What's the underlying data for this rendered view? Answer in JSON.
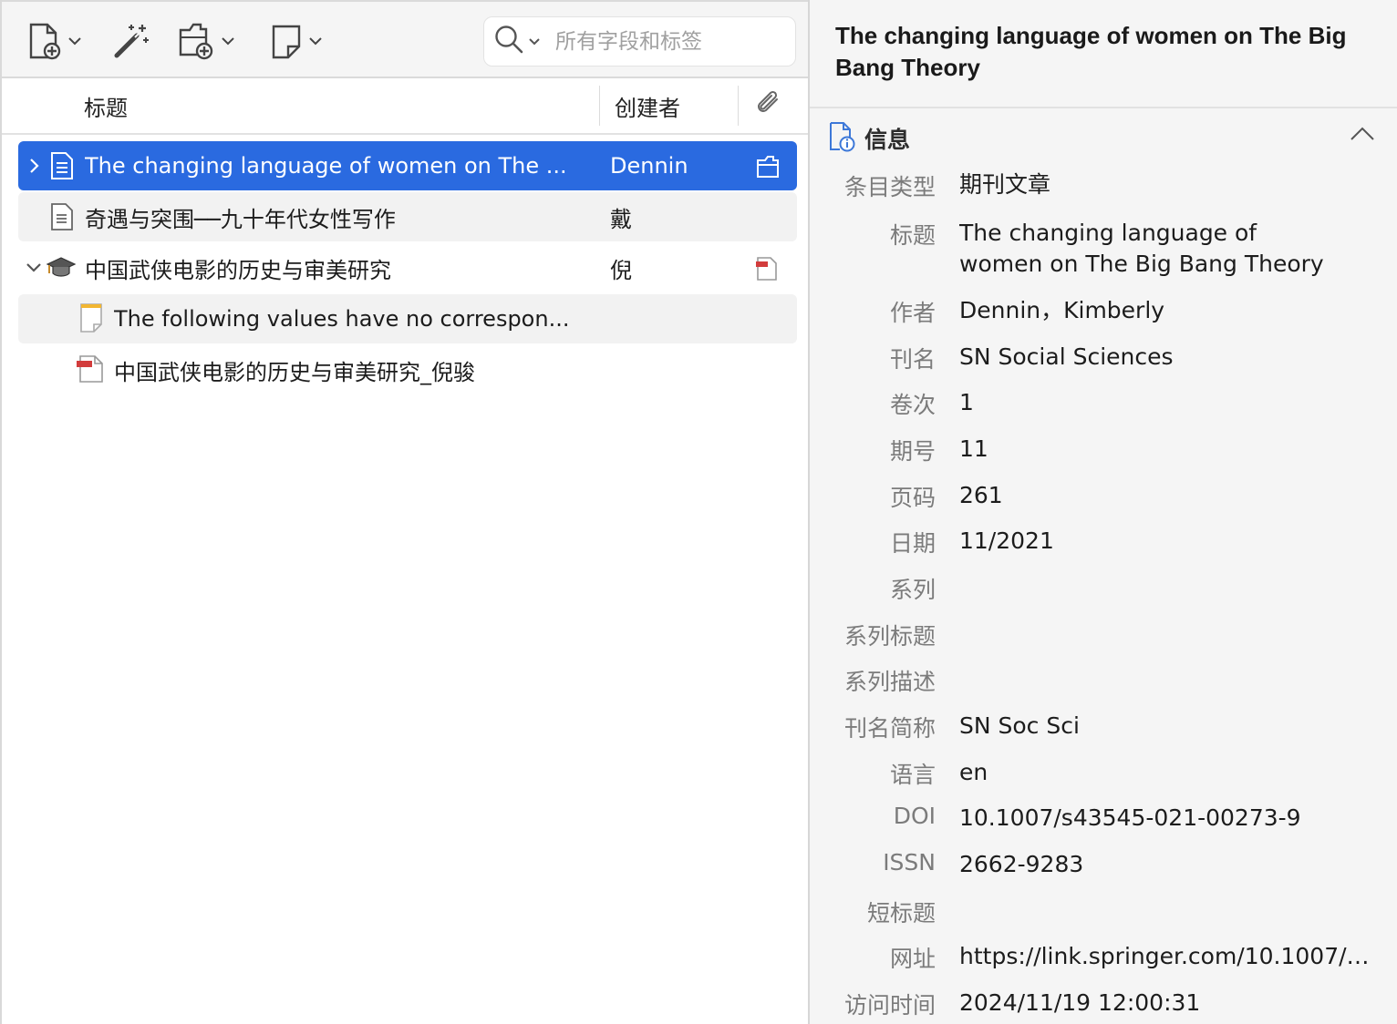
{
  "toolbar": {
    "new_item_icon": "new-item-icon",
    "wand_icon": "magic-wand-icon",
    "add_attachment_icon": "add-attachment-icon",
    "new_note_icon": "new-note-icon",
    "search_placeholder": "所有字段和标签"
  },
  "columns": {
    "title": "标题",
    "creator": "创建者",
    "attachment_icon": "paperclip-icon"
  },
  "items": [
    {
      "title": "The changing language of women on The ...",
      "creator": "Dennin",
      "icon": "journal-article-icon",
      "twisty": "collapsed",
      "attachment": "snapshot-icon",
      "level": 0,
      "selected": true
    },
    {
      "title": "奇遇与突围──九十年代女性写作",
      "creator": "戴",
      "icon": "document-icon",
      "twisty": "",
      "attachment": "",
      "level": 0,
      "selected": false
    },
    {
      "title": "中国武侠电影的历史与审美研究",
      "creator": "倪",
      "icon": "thesis-icon",
      "twisty": "expanded",
      "attachment": "pdf-icon",
      "level": 0,
      "selected": false
    },
    {
      "title": "The following values have no correspon...",
      "creator": "",
      "icon": "note-icon",
      "twisty": "",
      "attachment": "",
      "level": 1,
      "selected": false
    },
    {
      "title": "中国武侠电影的历史与审美研究_倪骏",
      "creator": "",
      "icon": "pdf-icon",
      "twisty": "",
      "attachment": "",
      "level": 1,
      "selected": false
    }
  ],
  "detail": {
    "title": "The changing language of women on The Big Bang Theory",
    "section_label": "信息",
    "fields": [
      {
        "label": "条目类型",
        "value": "期刊文章"
      },
      {
        "label": "标题",
        "value": "The changing language of women on The Big Bang Theory"
      },
      {
        "label": "作者",
        "value": "Dennin，Kimberly"
      },
      {
        "label": "刊名",
        "value": "SN Social Sciences"
      },
      {
        "label": "卷次",
        "value": "1"
      },
      {
        "label": "期号",
        "value": "11"
      },
      {
        "label": "页码",
        "value": "261"
      },
      {
        "label": "日期",
        "value": "11/2021"
      },
      {
        "label": "系列",
        "value": ""
      },
      {
        "label": "系列标题",
        "value": ""
      },
      {
        "label": "系列描述",
        "value": ""
      },
      {
        "label": "刊名简称",
        "value": "SN Soc Sci"
      },
      {
        "label": "语言",
        "value": "en"
      },
      {
        "label": "DOI",
        "value": "10.1007/s43545-021-00273-9"
      },
      {
        "label": "ISSN",
        "value": "2662-9283"
      },
      {
        "label": "短标题",
        "value": ""
      },
      {
        "label": "网址",
        "value": "https://link.springer.com/10.1007/s4..."
      },
      {
        "label": "访问时间",
        "value": "2024/11/19 12:00:31"
      }
    ]
  },
  "colors": {
    "selection": "#2a6ae0",
    "pdf_red": "#d23c3c",
    "note_yellow": "#f2b632"
  }
}
